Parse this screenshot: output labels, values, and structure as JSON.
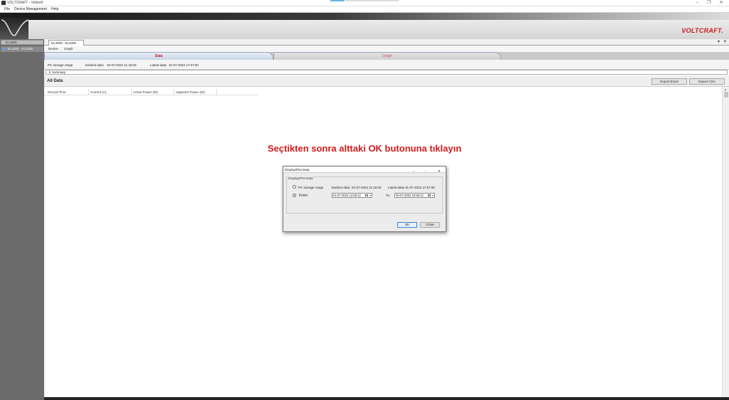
{
  "window": {
    "title": "VOLTCRAFT - Voltsoft"
  },
  "menu": [
    "File",
    "Device Management",
    "Help"
  ],
  "brand": "VOLTCRAFT.",
  "sidebar": {
    "header": "EL4000",
    "node": "EL4000 - EL4000"
  },
  "doc_tab": "EL4000 - EL4000",
  "sub_tabs": [
    "Device",
    "Graph"
  ],
  "big_tabs": {
    "data": "Data",
    "graph": "Graph"
  },
  "storage": {
    "label": "PC storage range",
    "earliest_label": "Earliest data:",
    "earliest_value": "02-07-2022 11:15:00",
    "latest_label": "Latest data:",
    "latest_value": "31-07-2022 17:57:00"
  },
  "summary_label": "Summary",
  "all_data": {
    "title": "All Data",
    "export_excel": "Export Excel",
    "export_csv": "Export CSV",
    "columns": [
      "Record Time",
      "Current (A)",
      "Active Power (W)",
      "Apparent Power (W)"
    ]
  },
  "caption": "Seçtikten sonra alttaki OK butonuna tıklayın",
  "dialog": {
    "title": "Display/Plot Data",
    "group_label": "Display/Plot Data",
    "option_storage": "PC storage range",
    "earliest_label": "Earliest data:",
    "earliest_value": "02-07-2022 11:15:00",
    "latest_label": "Latest data:",
    "latest_value": "31-07-2022 17:57:00",
    "option_from": "From:",
    "from_value": "01-07-2022 14:56:12",
    "to_label": "To:",
    "to_value": "30-07-2022 15:56:12",
    "ok": "OK",
    "close": "Close"
  }
}
